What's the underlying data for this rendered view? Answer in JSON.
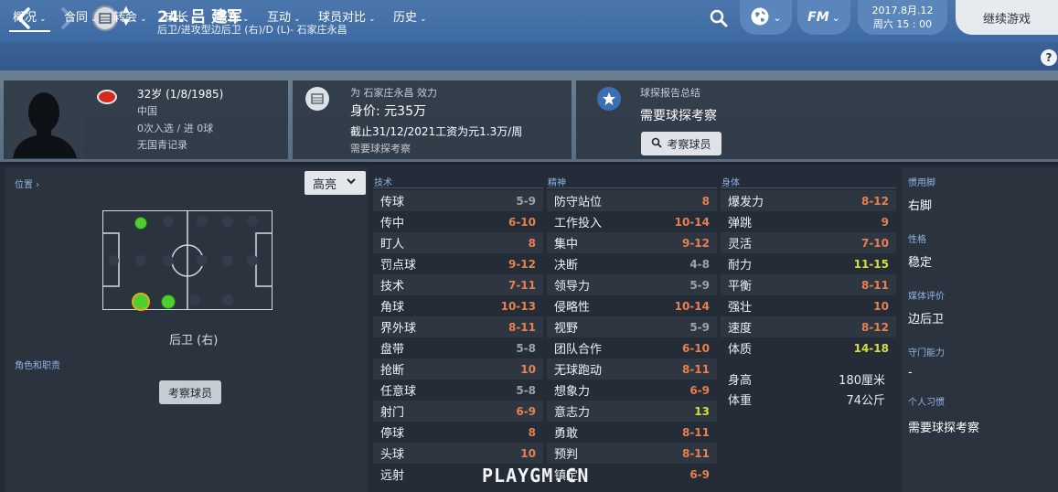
{
  "header": {
    "player_title": "24. 吕 建军",
    "player_subtitle": "后卫/进攻型边后卫 (右)/D (L)- 石家庄永昌",
    "date_line1": "2017.8月.12",
    "date_line2": "周六 15 : 00",
    "continue_label": "继续游戏",
    "fm_label": "FM"
  },
  "tabs": [
    {
      "label": "概况",
      "caret": "⌄"
    },
    {
      "label": "合同",
      "caret": "⌄"
    },
    {
      "label": "转会",
      "caret": "⌄"
    },
    {
      "label": "成长",
      "caret": "⌄"
    },
    {
      "label": "报告",
      "caret": "⌄"
    },
    {
      "label": "互动",
      "caret": "⌄"
    },
    {
      "label": "球员对比",
      "caret": "⌄"
    },
    {
      "label": "历史",
      "caret": "⌄"
    }
  ],
  "help": "?",
  "profile": {
    "age_dob": "32岁 (1/8/1985)",
    "nation": "中国",
    "caps": "0次入选 / 进 0球",
    "youth": "无国青记录"
  },
  "contract": {
    "club_line": "为 石家庄永昌 效力",
    "value": "身价: 元35万",
    "wage": "截止31/12/2021工资为元1.3万/周",
    "note": "需要球探考察"
  },
  "scout": {
    "title": "球探报告总结",
    "status": "需要球探考察",
    "button": "考察球员"
  },
  "left": {
    "position_label": "位置 ›",
    "position_name": "后卫 (右)",
    "role_label": "角色和职责",
    "scout_button": "考察球员",
    "highlight_label": "高亮"
  },
  "columns": {
    "technical": "技术",
    "mental": "精神",
    "physical": "身体"
  },
  "technical": [
    {
      "name": "传球",
      "value": "5-9",
      "color": "#9aa3ad"
    },
    {
      "name": "传中",
      "value": "6-10",
      "color": "#e8804f"
    },
    {
      "name": "盯人",
      "value": "8",
      "color": "#e8804f"
    },
    {
      "name": "罚点球",
      "value": "9-12",
      "color": "#e8804f"
    },
    {
      "name": "技术",
      "value": "7-11",
      "color": "#e8804f"
    },
    {
      "name": "角球",
      "value": "10-13",
      "color": "#e8804f"
    },
    {
      "name": "界外球",
      "value": "8-11",
      "color": "#e8804f"
    },
    {
      "name": "盘带",
      "value": "5-8",
      "color": "#9aa3ad"
    },
    {
      "name": "抢断",
      "value": "10",
      "color": "#e8804f"
    },
    {
      "name": "任意球",
      "value": "5-8",
      "color": "#9aa3ad"
    },
    {
      "name": "射门",
      "value": "6-9",
      "color": "#e8804f"
    },
    {
      "name": "停球",
      "value": "8",
      "color": "#e8804f"
    },
    {
      "name": "头球",
      "value": "10",
      "color": "#e8804f"
    },
    {
      "name": "远射",
      "value": "",
      "color": "#e8804f"
    }
  ],
  "mental": [
    {
      "name": "防守站位",
      "value": "8",
      "color": "#e8804f"
    },
    {
      "name": "工作投入",
      "value": "10-14",
      "color": "#e8804f"
    },
    {
      "name": "集中",
      "value": "9-12",
      "color": "#e8804f"
    },
    {
      "name": "决断",
      "value": "4-8",
      "color": "#9aa3ad"
    },
    {
      "name": "领导力",
      "value": "5-9",
      "color": "#9aa3ad"
    },
    {
      "name": "侵略性",
      "value": "10-14",
      "color": "#e8804f"
    },
    {
      "name": "视野",
      "value": "5-9",
      "color": "#9aa3ad"
    },
    {
      "name": "团队合作",
      "value": "6-10",
      "color": "#e8804f"
    },
    {
      "name": "无球跑动",
      "value": "8-11",
      "color": "#e8804f"
    },
    {
      "name": "想象力",
      "value": "6-9",
      "color": "#e8804f"
    },
    {
      "name": "意志力",
      "value": "13",
      "color": "#d7dd39"
    },
    {
      "name": "勇敢",
      "value": "8-11",
      "color": "#e8804f"
    },
    {
      "name": "预判",
      "value": "8-11",
      "color": "#e8804f"
    },
    {
      "name": "镇定",
      "value": "6-9",
      "color": "#e8804f"
    }
  ],
  "physical": [
    {
      "name": "爆发力",
      "value": "8-12",
      "color": "#e8804f"
    },
    {
      "name": "弹跳",
      "value": "9",
      "color": "#e8804f"
    },
    {
      "name": "灵活",
      "value": "7-10",
      "color": "#e8804f"
    },
    {
      "name": "耐力",
      "value": "11-15",
      "color": "#d7dd39"
    },
    {
      "name": "平衡",
      "value": "8-11",
      "color": "#e8804f"
    },
    {
      "name": "强壮",
      "value": "10",
      "color": "#e8804f"
    },
    {
      "name": "速度",
      "value": "8-12",
      "color": "#e8804f"
    },
    {
      "name": "体质",
      "value": "14-18",
      "color": "#d7dd39"
    }
  ],
  "body": {
    "height_label": "身高",
    "height": "180厘米",
    "weight_label": "体重",
    "weight": "74公斤"
  },
  "side": {
    "foot_label": "惯用脚",
    "foot": "右脚",
    "personality_label": "性格",
    "personality": "稳定",
    "media_label": "媒体评价",
    "media": "边后卫",
    "gk_label": "守门能力",
    "gk": "-",
    "habits_label": "个人习惯",
    "habits": "需要球探考察"
  },
  "watermark": "PLAYGM.CN"
}
